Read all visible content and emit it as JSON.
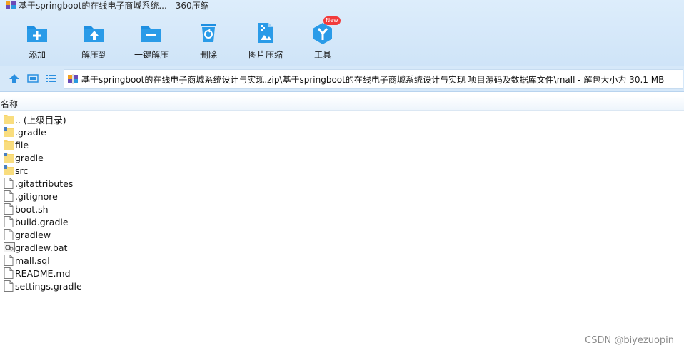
{
  "window": {
    "title": "基于springboot的在线电子商城系统... - 360压缩"
  },
  "toolbar": {
    "items": [
      {
        "label": "添加",
        "icon": "add-file-icon"
      },
      {
        "label": "解压到",
        "icon": "extract-to-icon"
      },
      {
        "label": "一键解压",
        "icon": "one-click-extract-icon"
      },
      {
        "label": "删除",
        "icon": "delete-icon"
      },
      {
        "label": "图片压缩",
        "icon": "image-compress-icon"
      },
      {
        "label": "工具",
        "icon": "tools-icon",
        "badge": "New"
      }
    ]
  },
  "address": {
    "path": "基于springboot的在线电子商城系统设计与实现.zip\\基于springboot的在线电子商城系统设计与实现 项目源码及数据库文件\\mall - 解包大小为 30.1 MB"
  },
  "list": {
    "header": "名称",
    "rows": [
      {
        "name": ".. (上级目录)",
        "kind": "parent-folder"
      },
      {
        "name": ".gradle",
        "kind": "folder-special"
      },
      {
        "name": "file",
        "kind": "folder"
      },
      {
        "name": "gradle",
        "kind": "folder-special"
      },
      {
        "name": "src",
        "kind": "folder-special"
      },
      {
        "name": ".gitattributes",
        "kind": "file"
      },
      {
        "name": ".gitignore",
        "kind": "file"
      },
      {
        "name": "boot.sh",
        "kind": "file"
      },
      {
        "name": "build.gradle",
        "kind": "file"
      },
      {
        "name": "gradlew",
        "kind": "file"
      },
      {
        "name": "gradlew.bat",
        "kind": "bat-file"
      },
      {
        "name": "mall.sql",
        "kind": "file"
      },
      {
        "name": "README.md",
        "kind": "file"
      },
      {
        "name": "settings.gradle",
        "kind": "file"
      }
    ]
  },
  "watermark": "CSDN @biyezuopin",
  "colors": {
    "accent": "#1e8fe1",
    "folder": "#f7d469",
    "toolbar_bg": "#d6e8f9"
  }
}
